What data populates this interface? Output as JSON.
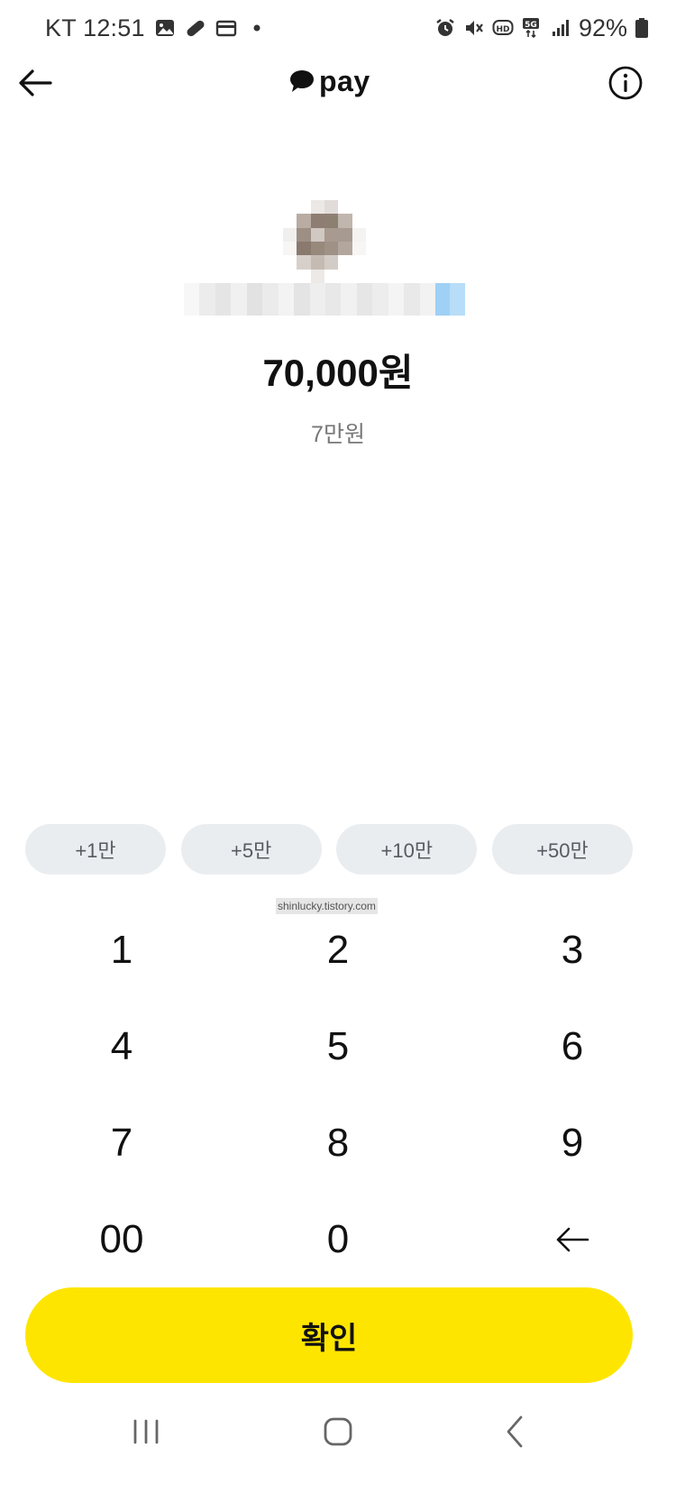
{
  "status_bar": {
    "carrier_time": "KT 12:51",
    "battery": "92%",
    "icons_left": [
      "gallery-icon",
      "pill-icon",
      "card-icon",
      "dot-icon"
    ],
    "icons_right": [
      "alarm-icon",
      "mute-icon",
      "hd-icon",
      "5g-icon",
      "signal-icon",
      "battery-icon"
    ]
  },
  "header": {
    "logo_text": "pay",
    "back_icon": "arrow-left-icon",
    "info_icon": "info-icon"
  },
  "transfer": {
    "amount": "70,000원",
    "amount_korean": "7만원"
  },
  "quick_add": [
    "+1만",
    "+5만",
    "+10만",
    "+50만"
  ],
  "watermark": "shinlucky.tistory.com",
  "keypad": {
    "keys": [
      "1",
      "2",
      "3",
      "4",
      "5",
      "6",
      "7",
      "8",
      "9",
      "00",
      "0"
    ],
    "backspace_icon": "backspace-arrow-icon"
  },
  "confirm_label": "확인",
  "nav_bar": {
    "icons": [
      "recent-apps-icon",
      "home-icon",
      "back-icon"
    ]
  },
  "colors": {
    "accent_yellow": "#fee500",
    "chip_bg": "#eaedf0",
    "text_dark": "#111111",
    "text_muted": "#777777"
  }
}
